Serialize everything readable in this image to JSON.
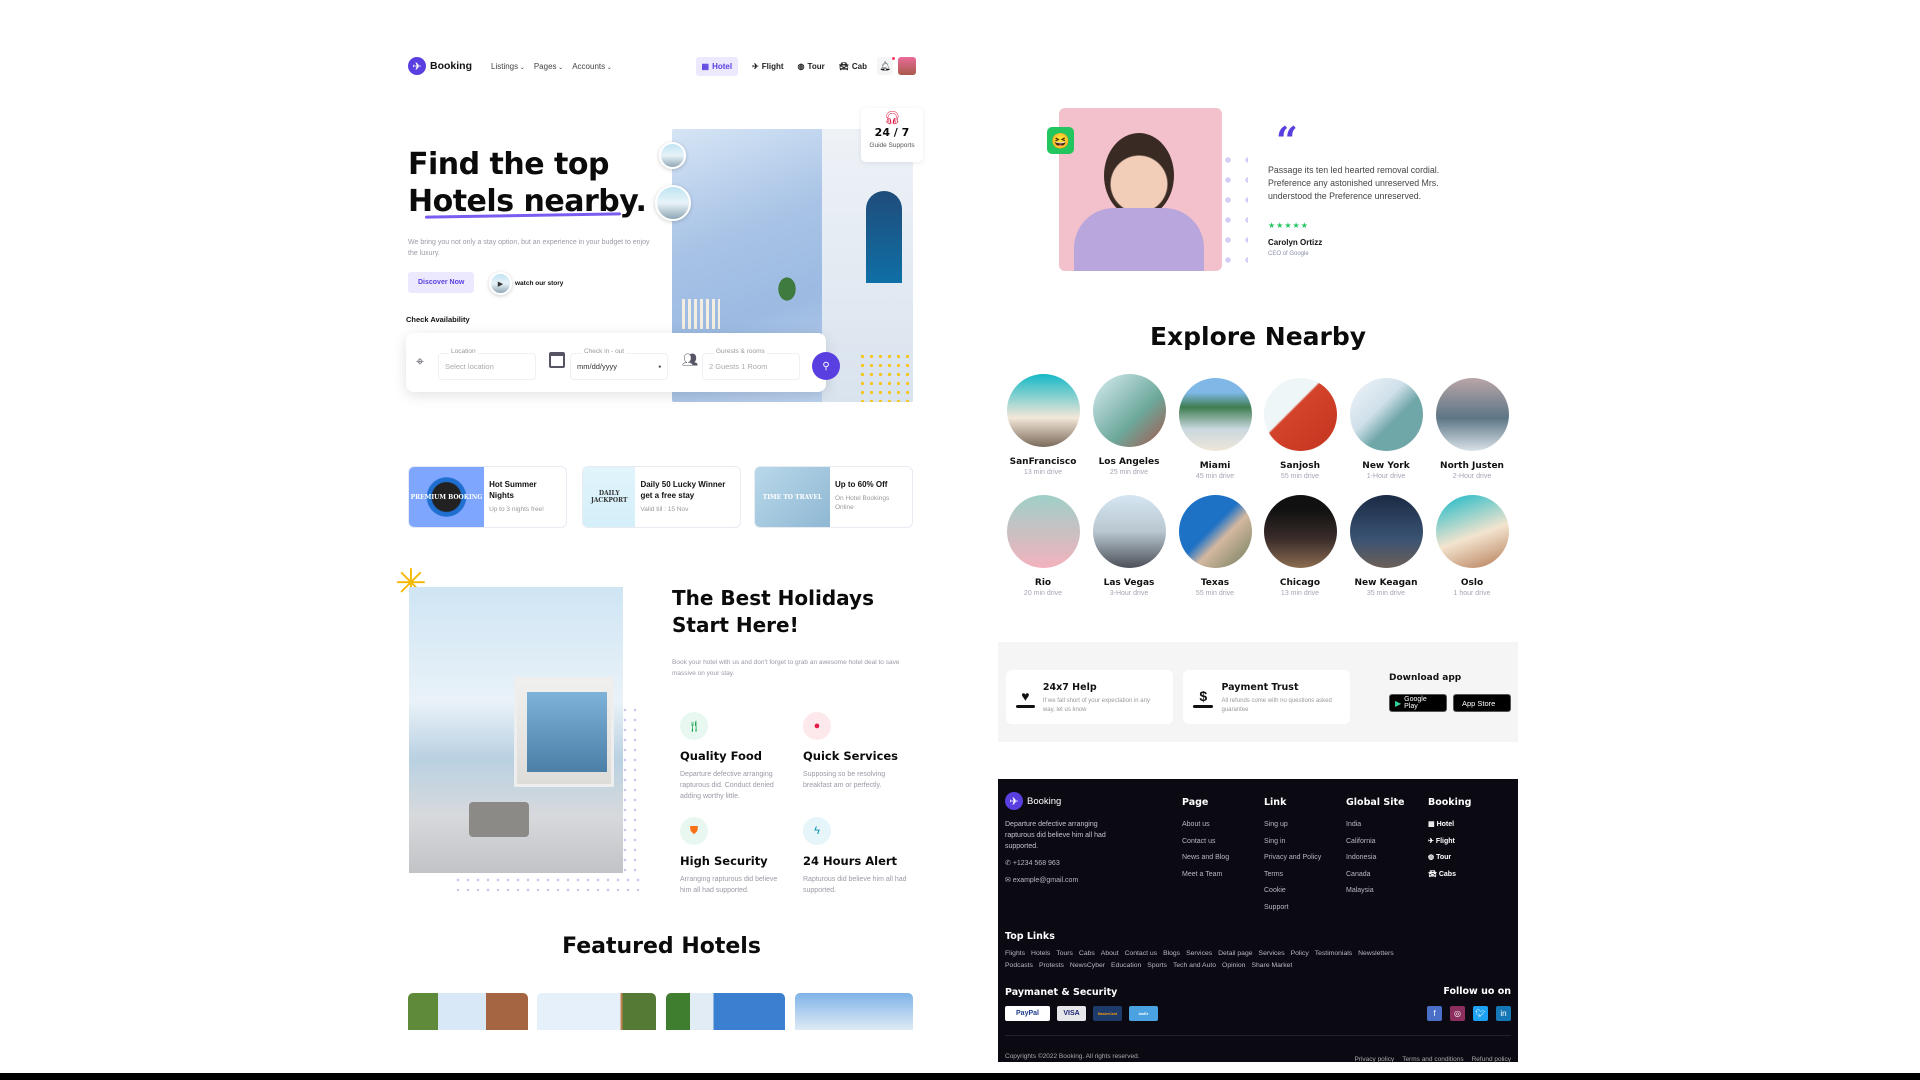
{
  "colors": {
    "accent": "#5a3fe0",
    "footer_bg": "#0b0a13",
    "star": "#22c55e"
  },
  "nav": {
    "brand": "Booking",
    "links": [
      "Listings",
      "Pages",
      "Accounts"
    ],
    "tabs": [
      {
        "label": "Hotel",
        "icon": "hotel-icon",
        "active": true
      },
      {
        "label": "Flight",
        "icon": "plane-icon"
      },
      {
        "label": "Tour",
        "icon": "globe-icon"
      },
      {
        "label": "Cab",
        "icon": "car-icon"
      }
    ]
  },
  "hero": {
    "title_line1": "Find the top",
    "title_line2": "Hotels nearby.",
    "subtitle": "We bring you not only a stay option, but an experience in your budget to enjoy the luxury.",
    "discover_label": "Discover Now",
    "watch_label": "watch our story",
    "support_value": "24 / 7",
    "support_label": "Guide Supports"
  },
  "search": {
    "heading": "Check Availability",
    "location": {
      "label": "Location",
      "placeholder": "Select location"
    },
    "dates": {
      "label": "Check in - out",
      "placeholder": "mm/dd/yyyy"
    },
    "guests": {
      "label": "Gurests & rooms",
      "placeholder": "2 Guests 1 Room"
    }
  },
  "promos": [
    {
      "title": "Hot Summer Nights",
      "sub": "Up to 3 nights free!",
      "img_text": "PREMIUM BOOKING"
    },
    {
      "title": "Daily 50 Lucky Winner get a free stay",
      "sub": "Valid till : 15 Nov",
      "img_text": "DAILY JACKPORT"
    },
    {
      "title": "Up to 60% Off",
      "sub": "On Hotel Bookings Online",
      "img_text": "TIME TO TRAVEL"
    }
  ],
  "holidays": {
    "title_line1": "The Best Holidays",
    "title_line2": "Start Here!",
    "desc": "Book your hotel with us and don't forget to grab an awesome hotel deal to save massive on your stay.",
    "features": [
      {
        "title": "Quality Food",
        "desc": "Departure defective arranging rapturous did. Conduct denied adding worthy little.",
        "icon": "utensils-icon"
      },
      {
        "title": "Quick Services",
        "desc": "Supposing so be resolving breakfast am or perfectly.",
        "icon": "bell-icon"
      },
      {
        "title": "High Security",
        "desc": "Arranging rapturous did believe him all had supported.",
        "icon": "shield-icon"
      },
      {
        "title": "24 Hours Alert",
        "desc": "Rapturous did believe him all had supported.",
        "icon": "bolt-icon"
      }
    ]
  },
  "featured": {
    "title": "Featured Hotels"
  },
  "testimonial": {
    "quote": "Passage its ten led hearted removal cordial. Preference any astonished unreserved Mrs. understood the Preference unreserved.",
    "rating": 5,
    "name": "Carolyn Ortizz",
    "role": "CEO of Google"
  },
  "explore": {
    "title": "Explore Nearby",
    "cities": [
      {
        "name": "SanFrancisco",
        "sub": "13 min drive"
      },
      {
        "name": "Los Angeles",
        "sub": "25 min drive"
      },
      {
        "name": "Miami",
        "sub": "45 min drive"
      },
      {
        "name": "Sanjosh",
        "sub": "55 min drive"
      },
      {
        "name": "New York",
        "sub": "1-Hour drive"
      },
      {
        "name": "North Justen",
        "sub": "2-Hour drive"
      },
      {
        "name": "Rio",
        "sub": "20 min drive"
      },
      {
        "name": "Las Vegas",
        "sub": "3-Hour drive"
      },
      {
        "name": "Texas",
        "sub": "55 min drive"
      },
      {
        "name": "Chicago",
        "sub": "13 min drive"
      },
      {
        "name": "New Keagan",
        "sub": "35 min drive"
      },
      {
        "name": "Oslo",
        "sub": "1 hour drive"
      }
    ]
  },
  "help": [
    {
      "title": "24x7 Help",
      "desc": "If we fall short of your expectation in any way, let us know"
    },
    {
      "title": "Payment Trust",
      "desc": "All refunds come with no questions asked guarantee"
    }
  ],
  "download": {
    "title": "Download app",
    "google": "Google Play",
    "apple": "App Store"
  },
  "footer": {
    "brand": "Booking",
    "about": "Departure defective arranging rapturous did believe him all had supported.",
    "phone": "+1234 568 963",
    "email": "example@gmail.com",
    "columns": [
      {
        "title": "Page",
        "links": [
          "About us",
          "Contact us",
          "News and Blog",
          "Meet a Team"
        ]
      },
      {
        "title": "Link",
        "links": [
          "Sing up",
          "Sing in",
          "Privacy and Policy",
          "Terms",
          "Cookie",
          "Support"
        ]
      },
      {
        "title": "Global Site",
        "links": [
          "India",
          "California",
          "Indonesia",
          "Canada",
          "Malaysia"
        ]
      },
      {
        "title": "Booking",
        "links": [
          "Hotel",
          "Flight",
          "Tour",
          "Cabs"
        ]
      }
    ],
    "top_links_title": "Top Links",
    "top_links": [
      "Flights",
      "Hotels",
      "Tours",
      "Cabs",
      "About",
      "Contact us",
      "Blogs",
      "Services",
      "Detail page",
      "Services",
      "Policy",
      "Testimonials",
      "Newsletters",
      "Podcasts",
      "Protests",
      "NewsCyber",
      "Education",
      "Sports",
      "Tech and Auto",
      "Opinion",
      "Share Market"
    ],
    "payment_title": "Paymanet & Security",
    "payments": [
      "PayPal",
      "VISA",
      "MasterCard",
      "AmEx"
    ],
    "follow_title": "Follow uo on",
    "socials": [
      "facebook",
      "instagram",
      "twitter",
      "linkedin"
    ],
    "copyright": "Copyrights ©2022 Booking. All rights reserved.",
    "legal": [
      "Privacy policy",
      "Terms and conditions",
      "Refund policy"
    ]
  }
}
